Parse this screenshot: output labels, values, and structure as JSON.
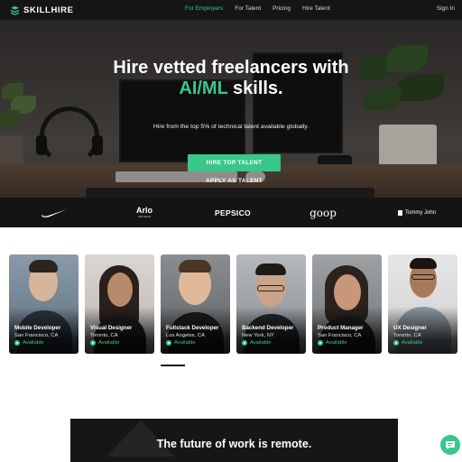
{
  "brand": {
    "name": "SKILLHIRE",
    "accent": "#38c88a"
  },
  "nav": {
    "links": [
      {
        "label": "For Employers",
        "active": true
      },
      {
        "label": "For Talent",
        "active": false
      },
      {
        "label": "Pricing",
        "active": false
      },
      {
        "label": "Hire Talent",
        "active": false
      }
    ],
    "signin": "Sign In"
  },
  "hero": {
    "title_line1": "Hire vetted freelancers with",
    "title_accent": "AI/ML",
    "title_line2_rest": " skills.",
    "subtitle": "Hire from the top 5% of technical talent available globally.",
    "primary_cta": "HIRE TOP TALENT",
    "secondary_cta": "APPLY AS TALENT"
  },
  "clients": {
    "nike_icon": "nike-swoosh-icon",
    "arlo": "Arlo",
    "arlo_sub": "NETGEAR",
    "pepsico": "PEPSICO",
    "goop": "goop",
    "tommy": "Tommy John"
  },
  "talent": [
    {
      "role": "Mobile Developer",
      "location": "San Francisco, CA",
      "status": "Available"
    },
    {
      "role": "Visual Designer",
      "location": "Toronto, CA",
      "status": "Available"
    },
    {
      "role": "Fullstack Developer",
      "location": "Los Angeles, CA",
      "status": "Available"
    },
    {
      "role": "Backend Developer",
      "location": "New York, NY",
      "status": "Available"
    },
    {
      "role": "Product Manager",
      "location": "San Francisco, CA",
      "status": "Available"
    },
    {
      "role": "UX Designer",
      "location": "Toronto, CA",
      "status": "Available"
    }
  ],
  "banner": {
    "title": "The future of work is remote."
  },
  "chat": {
    "icon": "chat-bubble-icon"
  }
}
